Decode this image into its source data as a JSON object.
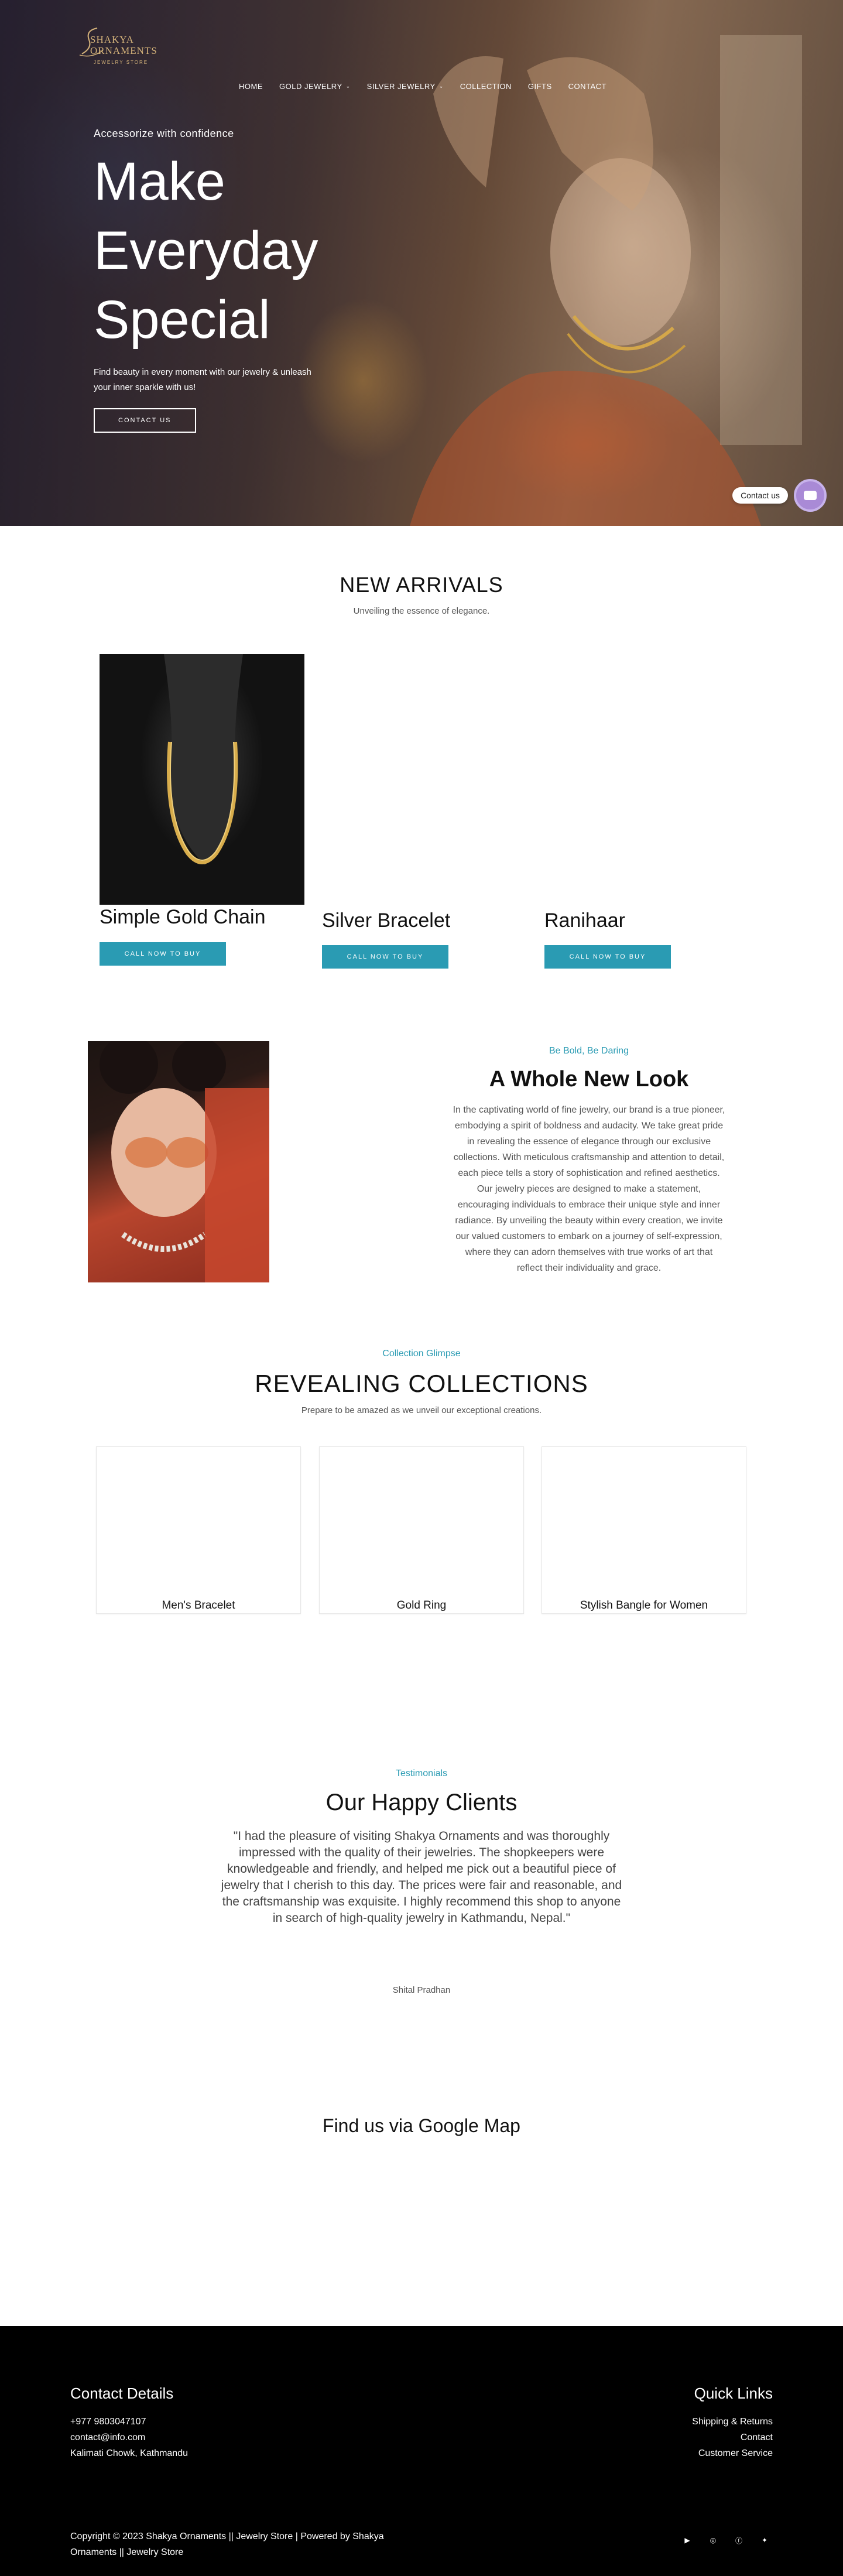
{
  "brand": {
    "name_line1": "SHAKYA",
    "name_line2": "ORNAMENTS",
    "tagline": "JEWELRY STORE",
    "logo_color": "#d4b27a"
  },
  "nav": {
    "items": [
      {
        "label": "HOME",
        "has_dropdown": false
      },
      {
        "label": "GOLD JEWELRY",
        "has_dropdown": true
      },
      {
        "label": "SILVER JEWELRY",
        "has_dropdown": true
      },
      {
        "label": "COLLECTION",
        "has_dropdown": false
      },
      {
        "label": "GIFTS",
        "has_dropdown": false
      },
      {
        "label": "CONTACT",
        "has_dropdown": false
      }
    ],
    "chevron_icon": "chevron-down-icon"
  },
  "hero": {
    "tagline": "Accessorize with confidence",
    "title_line1": "Make",
    "title_line2": "Everyday",
    "title_line3": "Special",
    "description": "Find beauty in every moment with our jewelry & unleash your inner sparkle with us!",
    "button_label": "CONTACT US"
  },
  "contact_widget": {
    "label": "Contact us",
    "icon": "chat-icon",
    "color": "#a98ad6"
  },
  "arrivals": {
    "title": "NEW ARRIVALS",
    "subtitle": "Unveiling the essence of elegance.",
    "products": [
      {
        "name": "Simple Gold Chain",
        "button": "CALL NOW TO BUY"
      },
      {
        "name": "Silver Bracelet",
        "button": "CALL NOW TO BUY"
      },
      {
        "name": "Ranihaar",
        "button": "CALL NOW TO BUY"
      }
    ],
    "accent_color": "#2a9bb3"
  },
  "look": {
    "eyebrow": "Be Bold, Be Daring",
    "title": "A Whole New Look",
    "body": "In the captivating world of fine jewelry, our brand is a true pioneer, embodying a spirit of boldness and audacity. We take great pride in revealing the essence of elegance through our exclusive collections. With meticulous craftsmanship and attention to detail, each piece tells a story of sophistication and refined aesthetics. Our jewelry pieces are designed to make a statement, encouraging individuals to embrace their unique style and inner radiance. By unveiling the beauty within every creation, we invite our valued customers to embark on a journey of self-expression, where they can adorn themselves with true works of art that reflect their individuality and grace."
  },
  "collections": {
    "eyebrow": "Collection Glimpse",
    "title": "REVEALING COLLECTIONS",
    "subtitle": "Prepare to be amazed as we unveil our exceptional creations.",
    "items": [
      {
        "name": "Men's Bracelet"
      },
      {
        "name": "Gold Ring"
      },
      {
        "name": "Stylish Bangle for Women"
      }
    ]
  },
  "testimonials": {
    "eyebrow": "Testimonials",
    "title": "Our Happy Clients",
    "quote": "\"I had the pleasure of visiting Shakya Ornaments and was thoroughly impressed with the quality of their jewelries. The shopkeepers were knowledgeable and friendly, and helped me pick out a beautiful piece of jewelry that I cherish to this day. The prices were fair and reasonable, and the craftsmanship was exquisite. I highly recommend this shop to anyone in search of high-quality jewelry in Kathmandu, Nepal.\"",
    "author": "Shital Pradhan"
  },
  "map": {
    "title": "Find us via Google Map"
  },
  "footer": {
    "contact_heading": "Contact Details",
    "phone": "+977 9803047107",
    "email": "contact@info.com",
    "address": "Kalimati Chowk, Kathmandu",
    "links_heading": "Quick Links",
    "links": [
      "Shipping & Returns",
      "Contact",
      "Customer Service"
    ],
    "copyright_line1": "Copyright © 2023 Shakya Ornaments || Jewelry Store | Powered by Shakya",
    "copyright_line2": "Ornaments || Jewelry Store",
    "social_icons": [
      "youtube-icon",
      "instagram-icon",
      "facebook-icon",
      "twitter-icon"
    ]
  }
}
